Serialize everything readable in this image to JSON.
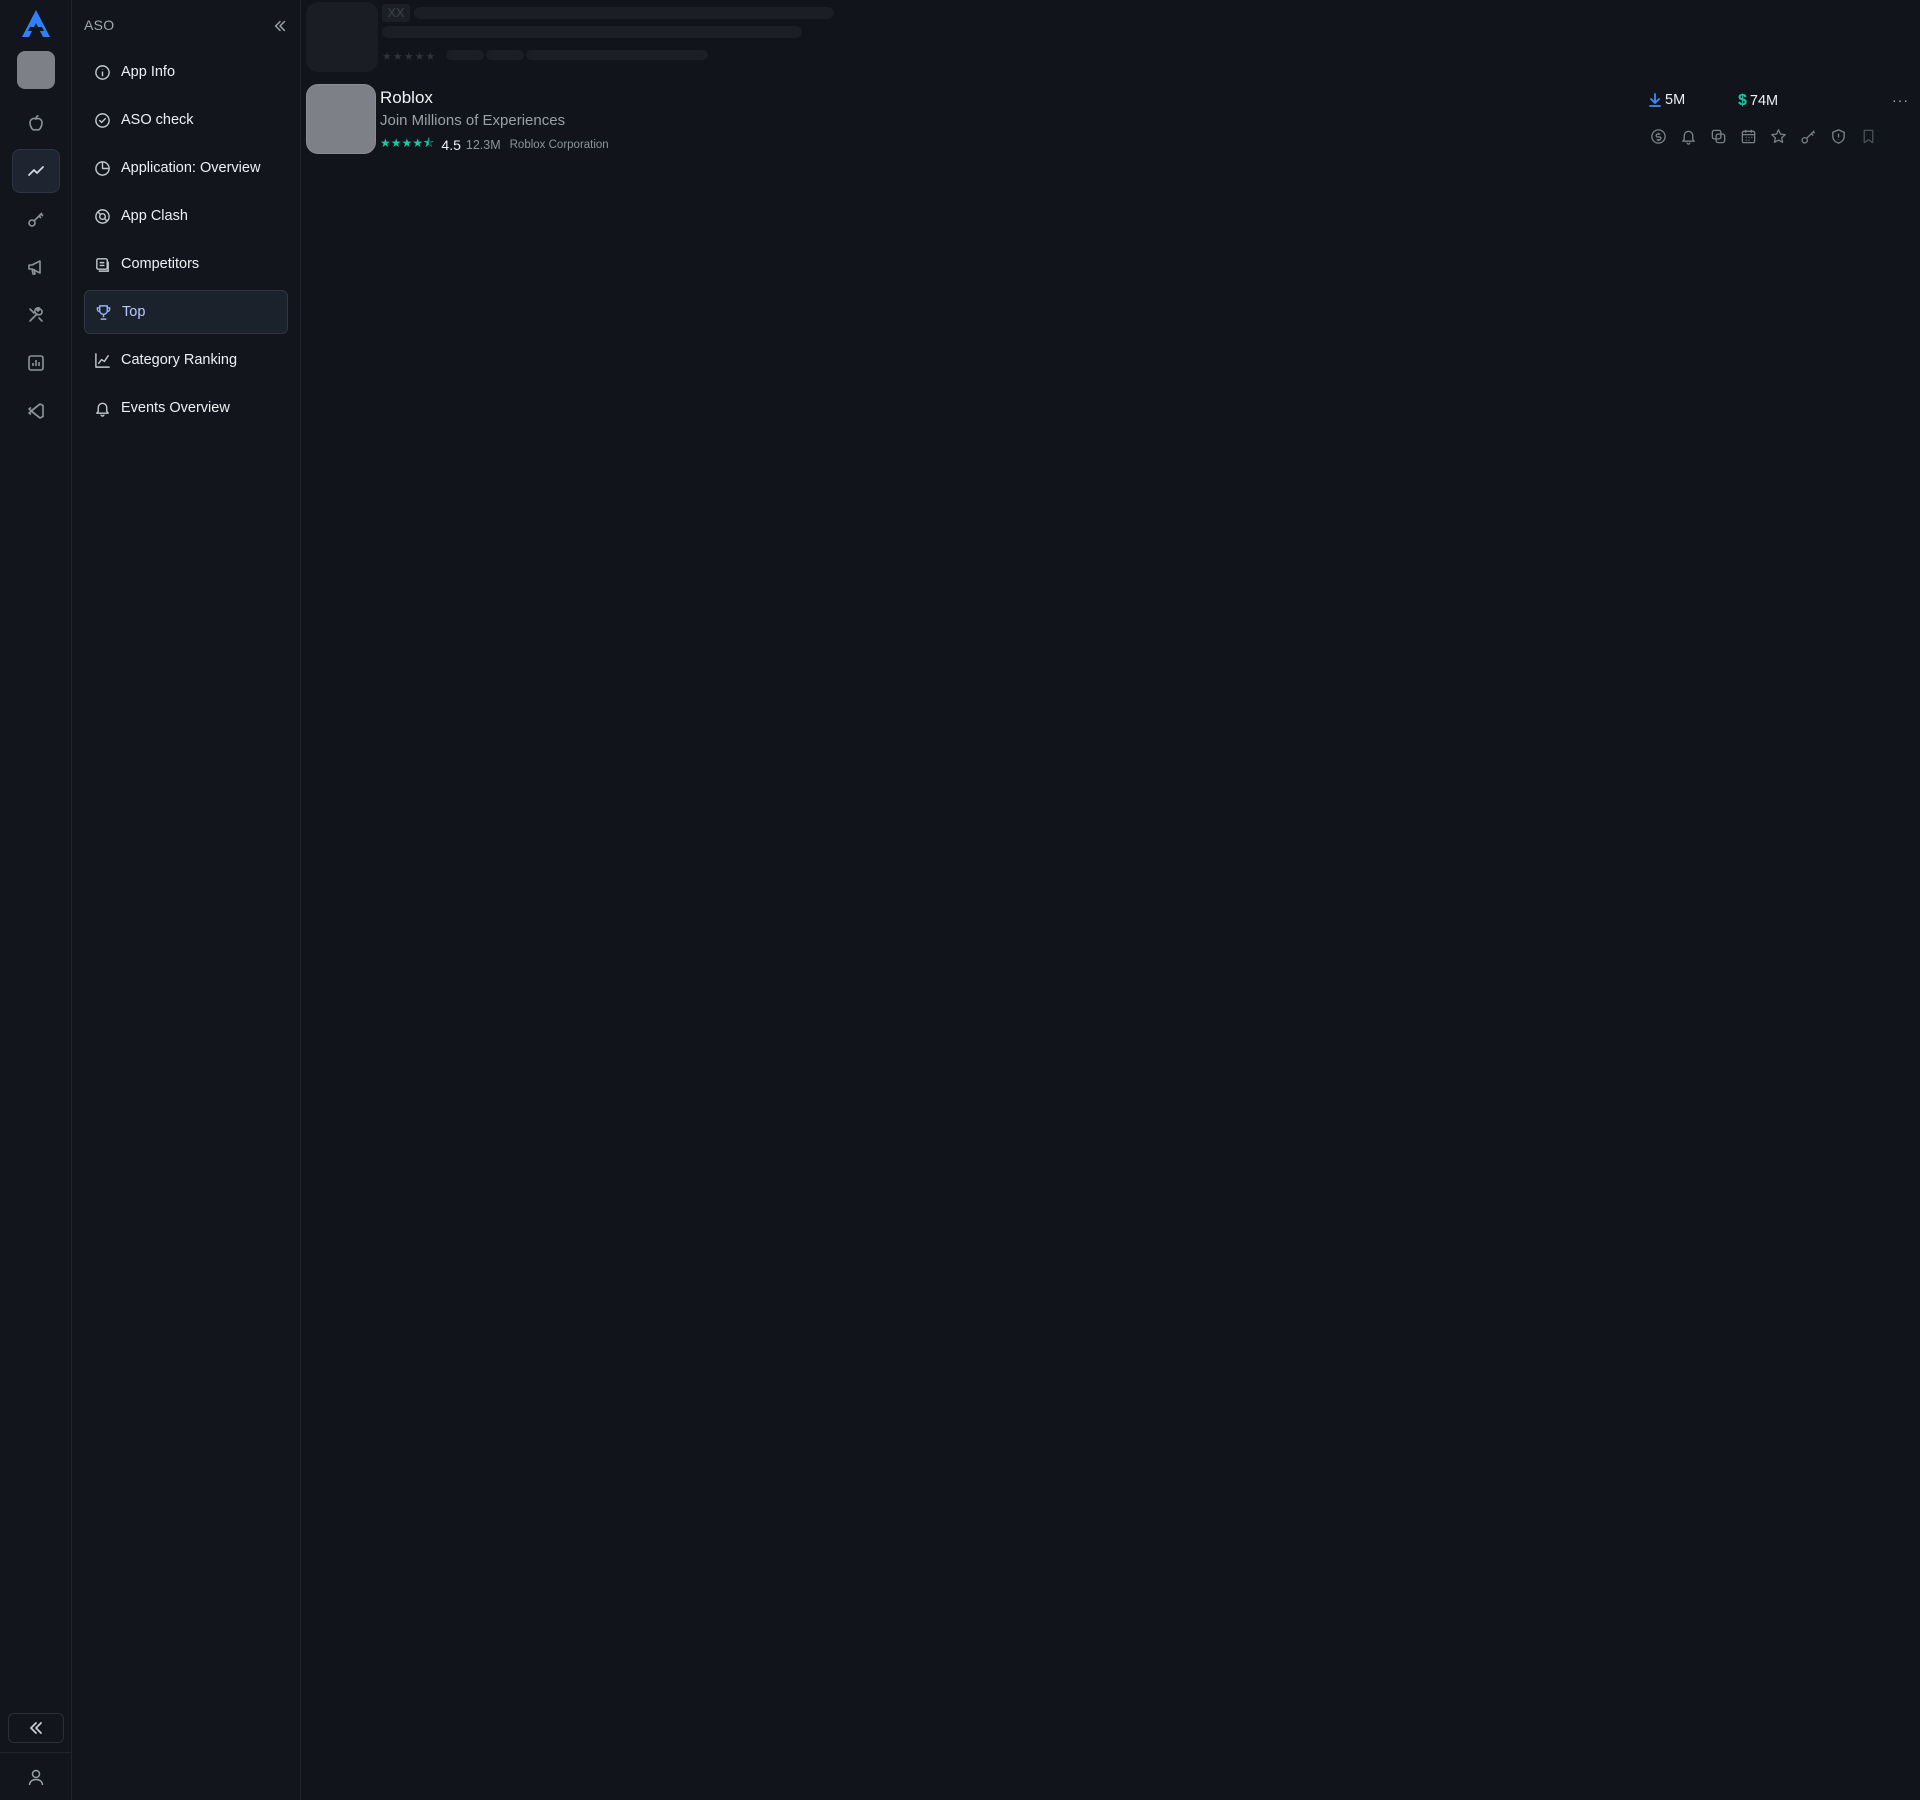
{
  "sidebar": {
    "title": "ASO",
    "items": [
      {
        "label": "App Info",
        "icon": "info-icon"
      },
      {
        "label": "ASO check",
        "icon": "check-circle-icon"
      },
      {
        "label": "Application: Overview",
        "icon": "pie-chart-icon"
      },
      {
        "label": "App Clash",
        "icon": "clash-icon"
      },
      {
        "label": "Competitors",
        "icon": "competitors-icon"
      },
      {
        "label": "Top",
        "icon": "trophy-icon",
        "active": true
      },
      {
        "label": "Category Ranking",
        "icon": "line-chart-icon"
      },
      {
        "label": "Events Overview",
        "icon": "bell-icon"
      }
    ]
  },
  "rail": {
    "items": [
      "apple-icon",
      "trend-icon",
      "key-icon",
      "megaphone-icon",
      "tools-icon",
      "bar-chart-icon",
      "vscode-icon"
    ],
    "active": "trend-icon"
  },
  "skeleton": {
    "placeholder": "XX"
  },
  "app": {
    "name": "Roblox",
    "subtitle": "Join Millions of Experiences",
    "stars": "★★★★⯪",
    "rating": "4.5",
    "ratings_count": "12.3M",
    "developer": "Roblox Corporation",
    "downloads": "5M",
    "revenue": "74M",
    "more": "···"
  },
  "colors": {
    "accent_blue": "#3b8cff",
    "accent_green": "#1ec7a6",
    "background": "#11141a"
  }
}
